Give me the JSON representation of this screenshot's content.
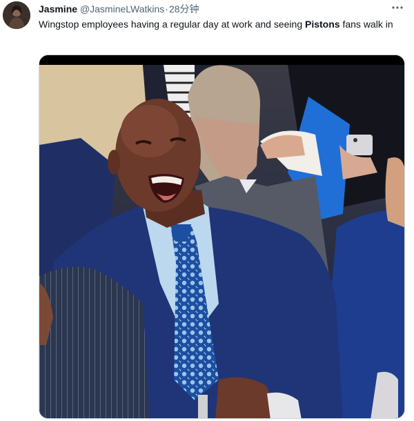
{
  "tweet": {
    "author_name": "Jasmine",
    "author_handle": "@JasmineLWatkins",
    "separator": "·",
    "time": "28分钟",
    "more_icon": "more-horizontal-icon",
    "text_before": "Wingstop employees having a regular day at work and seeing ",
    "text_bold": "Pistons",
    "text_after": " fans walk in"
  },
  "media": {
    "kind": "video-still",
    "subject": "man in navy suit and blue patterned tie laughing courtside, crowd behind"
  }
}
